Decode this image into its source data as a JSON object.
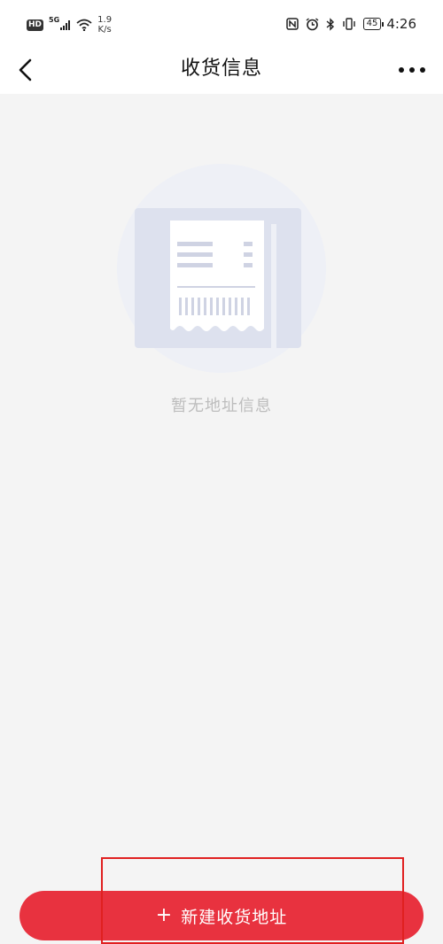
{
  "status_bar": {
    "hd": "HD",
    "network": "5G",
    "speed_value": "1.9",
    "speed_unit": "K/s",
    "battery": "45",
    "time": "4:26",
    "icons": [
      "nfc-icon",
      "alarm-icon",
      "bluetooth-icon",
      "vibrate-icon",
      "battery-icon"
    ]
  },
  "header": {
    "title": "收货信息",
    "back_icon": "chevron-left-icon",
    "more_icon": "more-dots-icon"
  },
  "empty_state": {
    "message": "暂无地址信息",
    "illustration": "receipt-illustration"
  },
  "footer": {
    "add_button_icon": "+",
    "add_button_label": "新建收货地址"
  },
  "colors": {
    "accent": "#e8323f",
    "background": "#f4f4f4",
    "empty_text": "#bdbdbd",
    "highlight": "#e02020"
  }
}
